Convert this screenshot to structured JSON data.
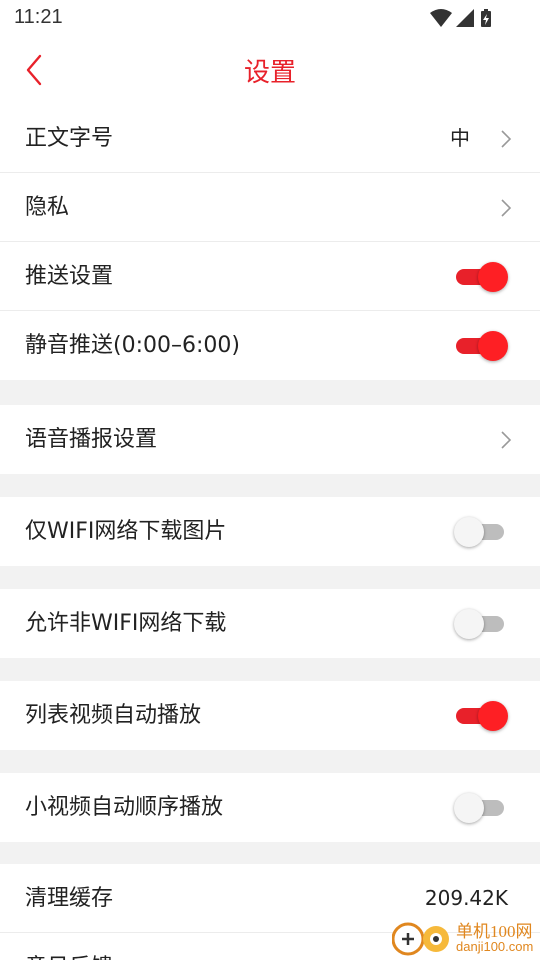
{
  "status_bar": {
    "time": "11:21",
    "icons": [
      "wifi-icon",
      "signal-icon",
      "battery-charging-icon"
    ]
  },
  "header": {
    "title": "设置",
    "back_icon": "back-arrow-icon",
    "accent_color": "#e8212a"
  },
  "settings": {
    "font_size": {
      "label": "正文字号",
      "value": "中"
    },
    "privacy": {
      "label": "隐私"
    },
    "push": {
      "label": "推送设置",
      "enabled": true
    },
    "mute_push": {
      "label": "静音推送(0:00–6:00)",
      "enabled": true
    },
    "voice_broadcast": {
      "label": "语音播报设置"
    },
    "wifi_images": {
      "label": "仅WIFI网络下载图片",
      "enabled": false
    },
    "non_wifi_download": {
      "label": "允许非WIFI网络下载",
      "enabled": false
    },
    "list_video_autoplay": {
      "label": "列表视频自动播放",
      "enabled": true
    },
    "short_video_autoplay": {
      "label": "小视频自动顺序播放",
      "enabled": false
    },
    "clear_cache": {
      "label": "清理缓存",
      "value": "209.42K"
    },
    "feedback": {
      "label": "意见反馈"
    }
  },
  "watermark": {
    "title": "单机100网",
    "url": "danji100.com"
  }
}
